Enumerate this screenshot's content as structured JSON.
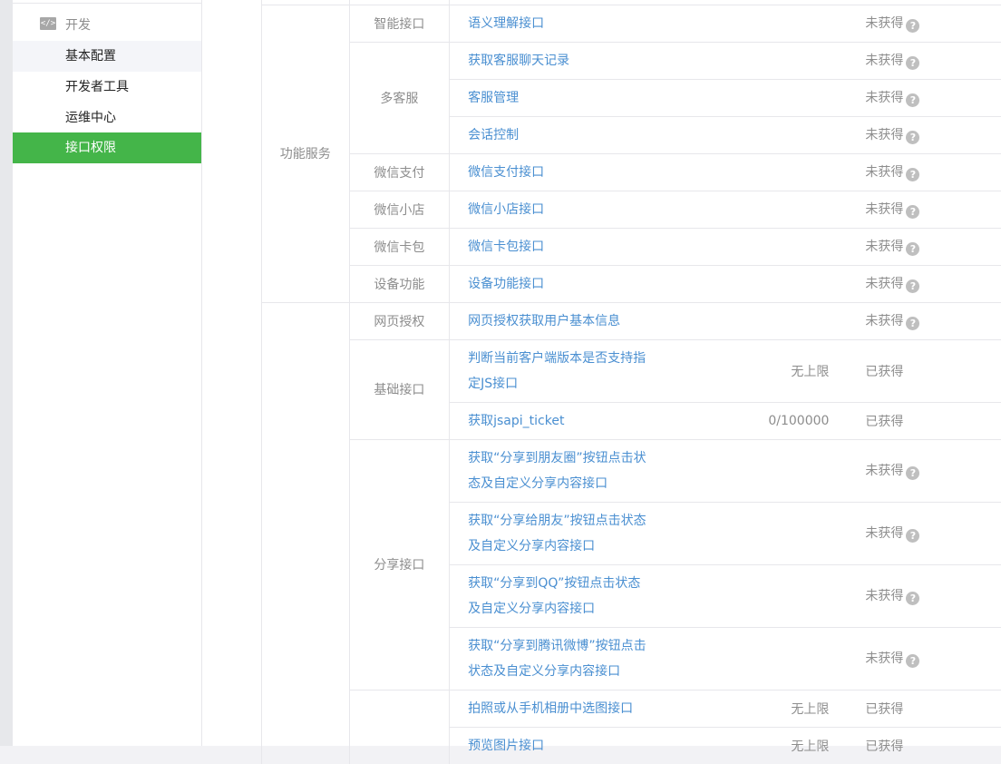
{
  "sidebar": {
    "section_icon": "code-icon",
    "section_icon_glyph": "</>",
    "section_label": "开发",
    "items": [
      {
        "label": "基本配置",
        "state": "hover"
      },
      {
        "label": "开发者工具",
        "state": "normal"
      },
      {
        "label": "运维中心",
        "state": "normal"
      },
      {
        "label": "接口权限",
        "state": "active"
      }
    ]
  },
  "colors": {
    "accent": "#44b549",
    "link": "#4a8fd1",
    "muted": "#8d8d8d"
  },
  "table": {
    "groups": [
      "功能服务"
    ],
    "categories": [
      "智能接口",
      "多客服",
      "微信支付",
      "微信小店",
      "微信卡包",
      "设备功能",
      "网页授权",
      "基础接口",
      "分享接口"
    ],
    "question_glyph": "?",
    "rows": [
      {
        "name": "语义理解接口",
        "limit": "",
        "status": "未获得"
      },
      {
        "name": "获取客服聊天记录",
        "limit": "",
        "status": "未获得"
      },
      {
        "name": "客服管理",
        "limit": "",
        "status": "未获得"
      },
      {
        "name": "会话控制",
        "limit": "",
        "status": "未获得"
      },
      {
        "name": "微信支付接口",
        "limit": "",
        "status": "未获得"
      },
      {
        "name": "微信小店接口",
        "limit": "",
        "status": "未获得"
      },
      {
        "name": "微信卡包接口",
        "limit": "",
        "status": "未获得"
      },
      {
        "name": "设备功能接口",
        "limit": "",
        "status": "未获得"
      },
      {
        "name": "网页授权获取用户基本信息",
        "limit": "",
        "status": "未获得"
      },
      {
        "name": "判断当前客户端版本是否支持指定JS接口",
        "limit": "无上限",
        "status": "已获得"
      },
      {
        "name": "获取jsapi_ticket",
        "limit": "0/100000",
        "status": "已获得"
      },
      {
        "name": "获取“分享到朋友圈”按钮点击状态及自定义分享内容接口",
        "limit": "",
        "status": "未获得"
      },
      {
        "name": "获取“分享给朋友”按钮点击状态及自定义分享内容接口",
        "limit": "",
        "status": "未获得"
      },
      {
        "name": "获取“分享到QQ”按钮点击状态及自定义分享内容接口",
        "limit": "",
        "status": "未获得"
      },
      {
        "name": "获取“分享到腾讯微博”按钮点击状态及自定义分享内容接口",
        "limit": "",
        "status": "未获得"
      },
      {
        "name": "拍照或从手机相册中选图接口",
        "limit": "无上限",
        "status": "已获得"
      },
      {
        "name": "预览图片接口",
        "limit": "无上限",
        "status": "已获得"
      }
    ]
  }
}
